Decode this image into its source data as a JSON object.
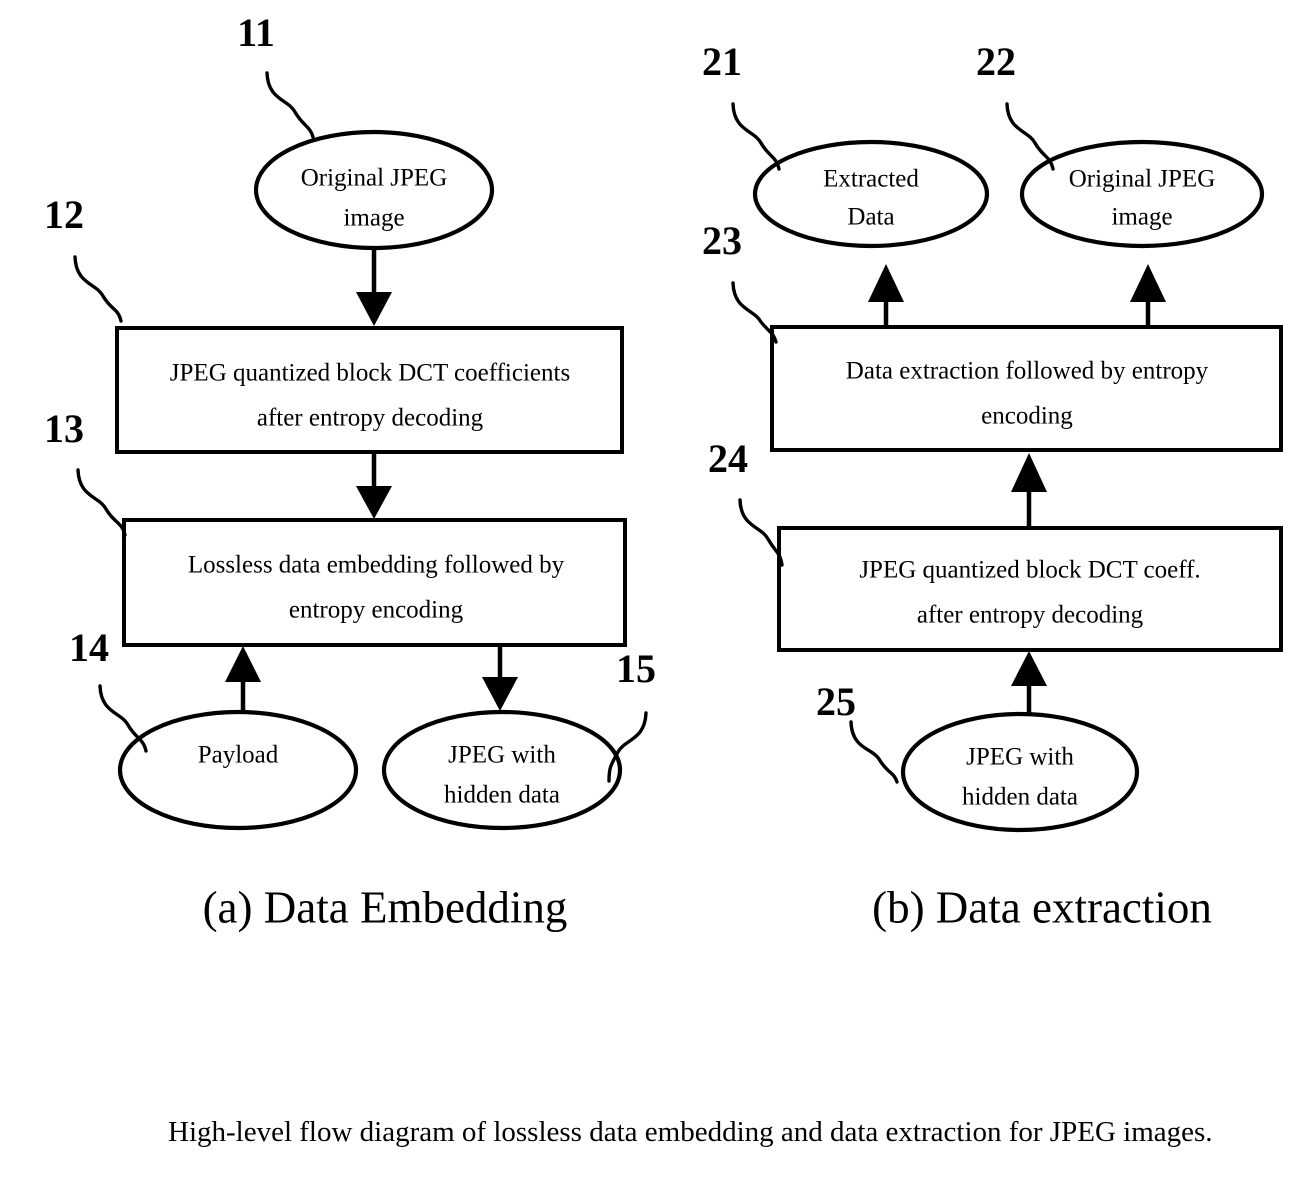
{
  "figure": {
    "caption": "High-level flow diagram of lossless data embedding and data extraction for JPEG images."
  },
  "panels": [
    {
      "id": "panel-a",
      "caption": "(a) Data Embedding",
      "nodes": [
        {
          "ref": "11",
          "shape": "ellipse",
          "line1": "Original JPEG",
          "line2": "image"
        },
        {
          "ref": "12",
          "shape": "box",
          "line1": "JPEG quantized block DCT coefficients",
          "line2": "after entropy decoding"
        },
        {
          "ref": "13",
          "shape": "box",
          "line1": "Lossless data embedding followed by",
          "line2": "entropy encoding"
        },
        {
          "ref": "14",
          "shape": "ellipse",
          "line1": "Payload",
          "line2": ""
        },
        {
          "ref": "15",
          "shape": "ellipse",
          "line1": "JPEG with",
          "line2": "hidden data"
        }
      ]
    },
    {
      "id": "panel-b",
      "caption": "(b) Data extraction",
      "nodes": [
        {
          "ref": "21",
          "shape": "ellipse",
          "line1": "Extracted",
          "line2": "Data"
        },
        {
          "ref": "22",
          "shape": "ellipse",
          "line1": "Original JPEG",
          "line2": "image"
        },
        {
          "ref": "23",
          "shape": "box",
          "line1": "Data extraction followed by entropy",
          "line2": "encoding"
        },
        {
          "ref": "24",
          "shape": "box",
          "line1": "JPEG quantized block DCT coeff.",
          "line2": "after entropy decoding"
        },
        {
          "ref": "25",
          "shape": "ellipse",
          "line1": "JPEG with",
          "line2": "hidden data"
        }
      ]
    }
  ],
  "style": {
    "stroke_color": "#000000",
    "fill_color": "#ffffff",
    "background": "#ffffff"
  }
}
